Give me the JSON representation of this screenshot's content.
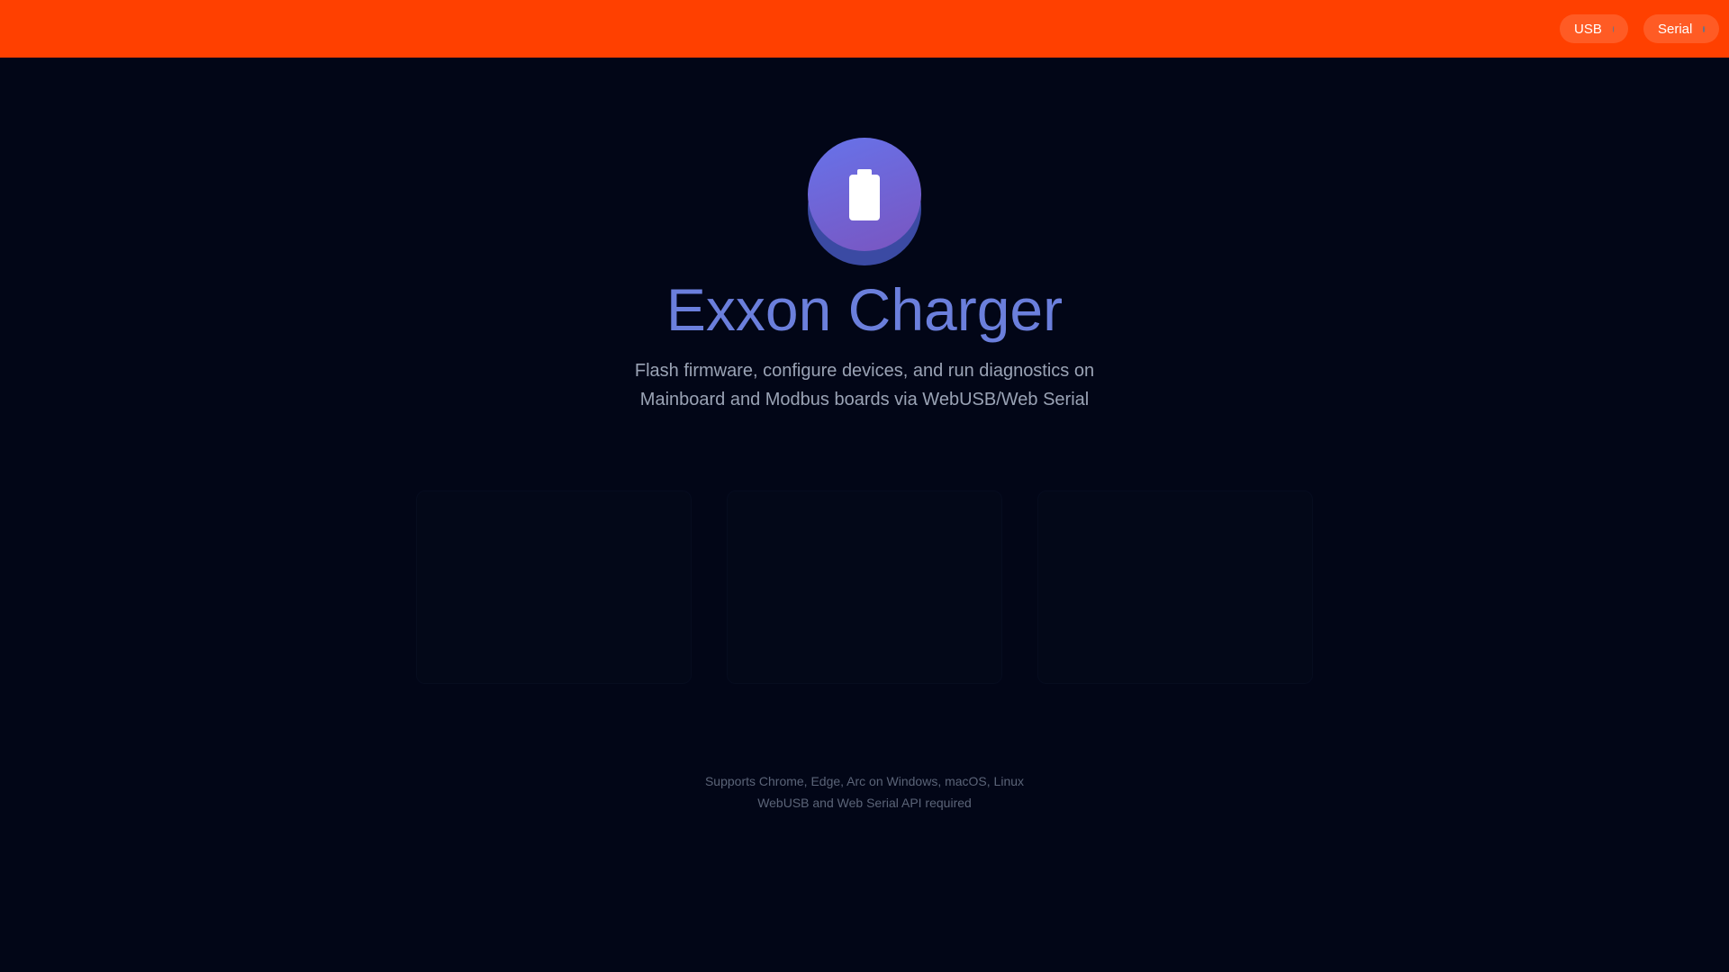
{
  "header": {
    "indicators": [
      {
        "label": "USB",
        "status_color": "#64748b"
      },
      {
        "label": "Serial",
        "status_color": "#64748b"
      }
    ],
    "background_color": "#ff4000"
  },
  "hero": {
    "icon": "battery-icon",
    "title": "Exxon Charger",
    "subtitle": "Flash firmware, configure devices, and run diagnostics on Mainboard and Modbus boards via WebUSB/Web Serial"
  },
  "cards": [
    {
      "label": ""
    },
    {
      "label": ""
    },
    {
      "label": ""
    }
  ],
  "footer": {
    "line1": "Supports Chrome, Edge, Arc on Windows, macOS, Linux",
    "line2": "WebUSB and Web Serial API required"
  },
  "colors": {
    "background": "#020617",
    "accent": "#6b7fdc"
  }
}
